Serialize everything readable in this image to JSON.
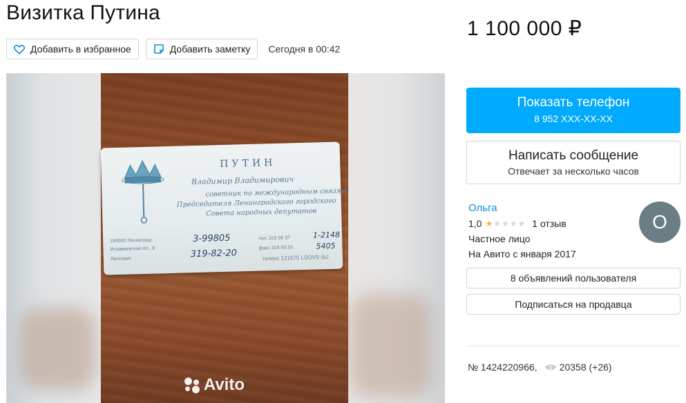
{
  "listing": {
    "title": "Визитка Путина",
    "price": "1 100 000 ₽",
    "date": "Сегодня в 00:42",
    "favorite_label": "Добавить в избранное",
    "note_label": "Добавить заметку",
    "number": "№ 1424220966,",
    "views": "20358 (+26)"
  },
  "gallery": {
    "watermark": "Avito",
    "card": {
      "surname": "ПУТИН",
      "name": "Владимир Владимирович",
      "line1": "советник по международным связям",
      "line2": "Председателя Ленинградского городского",
      "line3": "Совета народных депутатов",
      "addr1": "190000 Ленинград",
      "addr2": "Исаакиевская пл., 6",
      "addr3": "Ленсовет",
      "hand1": "3-99805",
      "hand2": "319-82-20",
      "hand3": "1-2148",
      "hand4": "5405",
      "tel": "тел. 319 98 37",
      "fax": "факс 319 93 33",
      "telex": "телекс 121575 LSOVS SU"
    }
  },
  "contact": {
    "phone_title": "Показать телефон",
    "phone_number": "8 952 XXX-XX-XX",
    "message_title": "Написать сообщение",
    "message_sub": "Отвечает за несколько часов"
  },
  "seller": {
    "name": "Ольга",
    "rating": "1,0",
    "stars": 1,
    "reviews": "1 отзыв",
    "type": "Частное лицо",
    "since": "На Авито с января 2017",
    "avatar_letter": "О",
    "ads_label": "8 объявлений пользователя",
    "subscribe_label": "Подписаться на продавца"
  },
  "colors": {
    "accent": "#00aaff",
    "link": "#0a8ed6",
    "star": "#ffb02e",
    "avatar": "#6b7d85"
  }
}
